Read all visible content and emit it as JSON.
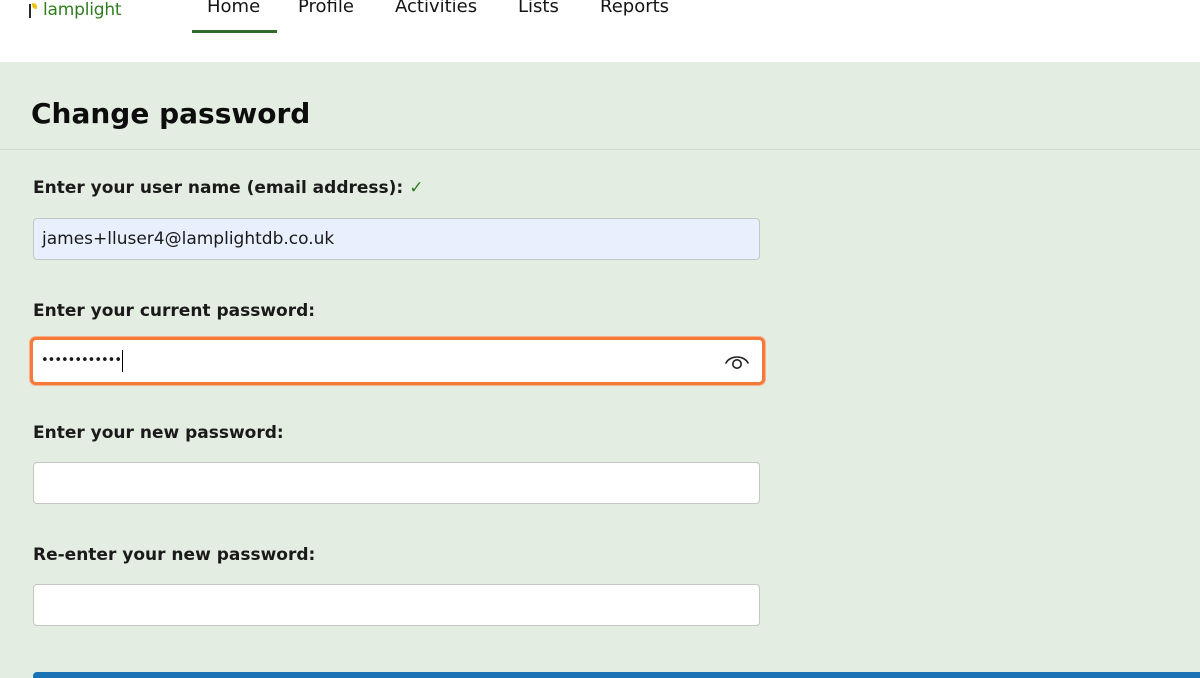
{
  "brand": {
    "name": "lamplight"
  },
  "nav": {
    "items": [
      {
        "label": "Home",
        "active": true
      },
      {
        "label": "Profile",
        "active": false
      },
      {
        "label": "Activities",
        "active": false
      },
      {
        "label": "Lists",
        "active": false
      },
      {
        "label": "Reports",
        "active": false
      }
    ]
  },
  "page": {
    "title": "Change password"
  },
  "form": {
    "username": {
      "label": "Enter your user name (email address):",
      "check": "✓",
      "value": "james+lluser4@lamplightdb.co.uk"
    },
    "current_password": {
      "label": "Enter your current password:",
      "masked_value": "••••••••••••",
      "reveal_icon": "eye-icon"
    },
    "new_password": {
      "label": "Enter your new password:",
      "value": ""
    },
    "confirm_password": {
      "label": "Re-enter your new password:",
      "value": ""
    }
  },
  "colors": {
    "page_background": "#e4ede1",
    "brand_green": "#2f7d1f",
    "focus_orange": "#f37a3a",
    "autofill_blue": "#e8f0fe",
    "primary_button": "#1a73b5"
  }
}
